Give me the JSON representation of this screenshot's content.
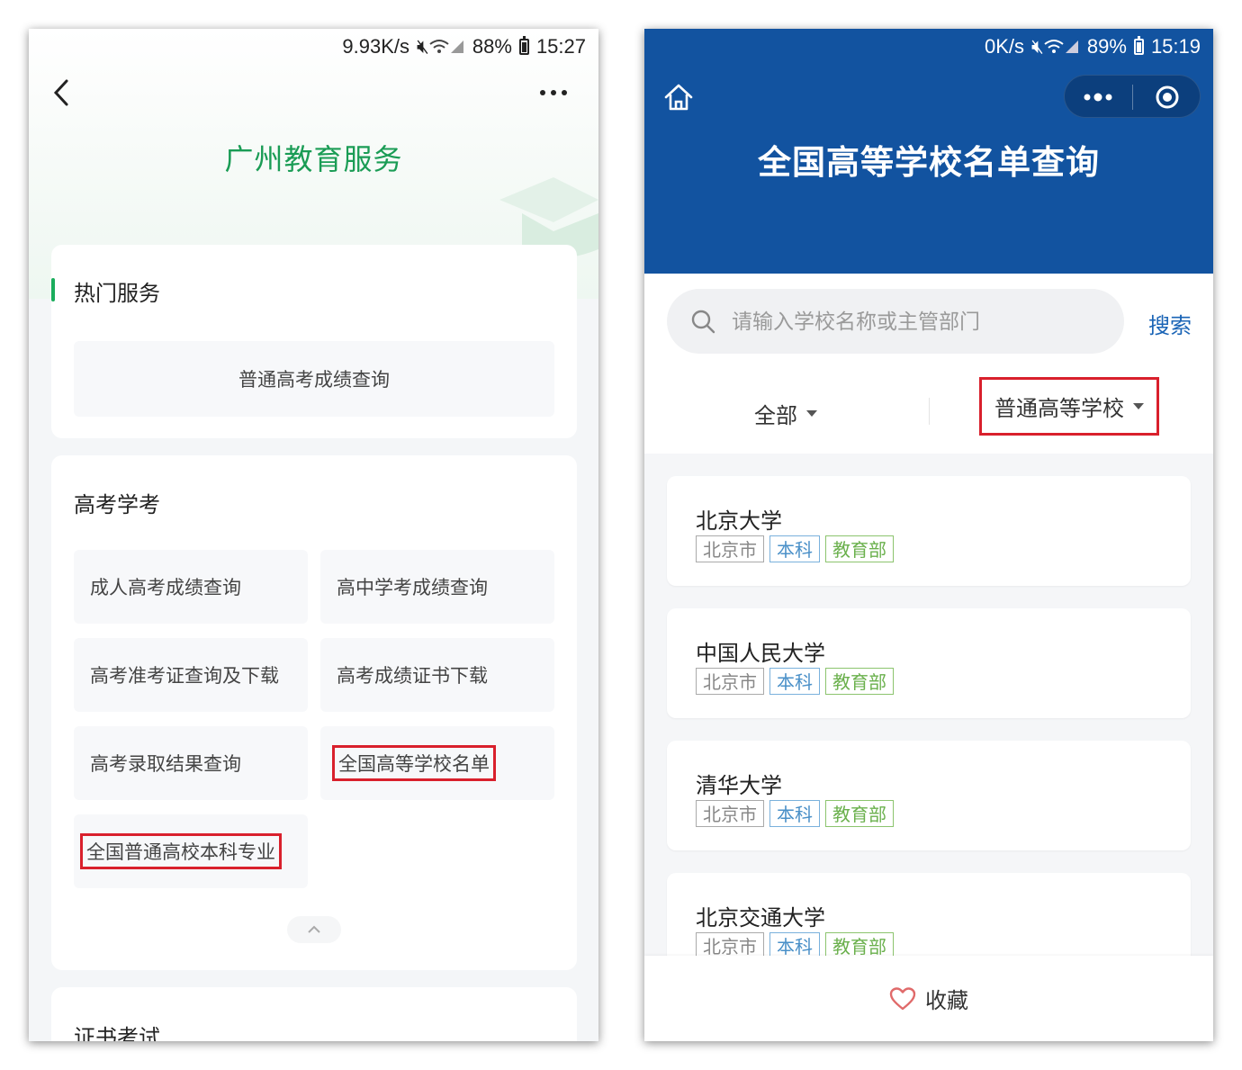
{
  "left": {
    "status": {
      "speed": "9.93K/s",
      "battery": "88%",
      "time": "15:27"
    },
    "title": "广州教育服务",
    "hot_section": {
      "title": "热门服务",
      "items": [
        "普通高考成绩查询"
      ]
    },
    "gk_section": {
      "title": "高考学考",
      "items": [
        "成人高考成绩查询",
        "高中学考成绩查询",
        "高考准考证查询及下载",
        "高考成绩证书下载",
        "高考录取结果查询",
        "全国高等学校名单",
        "全国普通高校本科专业"
      ]
    },
    "cert_section": {
      "title": "证书考试"
    }
  },
  "right": {
    "status": {
      "speed": "0K/s",
      "battery": "89%",
      "time": "15:19"
    },
    "title": "全国高等学校名单查询",
    "search": {
      "placeholder": "请输入学校名称或主管部门",
      "button": "搜索"
    },
    "filters": {
      "region": "全部",
      "type": "普通高等学校"
    },
    "universities": [
      {
        "name": "北京大学",
        "tags": [
          "北京市",
          "本科",
          "教育部"
        ]
      },
      {
        "name": "中国人民大学",
        "tags": [
          "北京市",
          "本科",
          "教育部"
        ]
      },
      {
        "name": "清华大学",
        "tags": [
          "北京市",
          "本科",
          "教育部"
        ]
      },
      {
        "name": "北京交通大学",
        "tags": [
          "北京市",
          "本科",
          "教育部"
        ]
      }
    ],
    "favorite_label": "收藏"
  },
  "colors": {
    "green_accent": "#1a9c55",
    "blue_header": "#1253a0",
    "highlight_red": "#d9202c"
  }
}
